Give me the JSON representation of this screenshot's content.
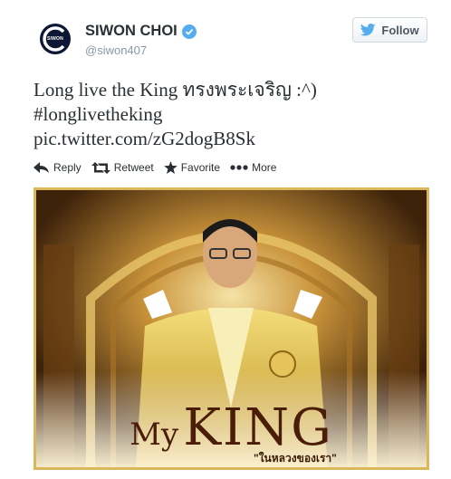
{
  "user": {
    "display_name": "SIWON CHOI",
    "handle": "@siwon407",
    "avatar_text": "SIWON",
    "verified": true
  },
  "follow_button": {
    "label": "Follow"
  },
  "tweet": {
    "lines": [
      "Long live the King ทรงพระเจริญ :^)",
      "#longlivetheking",
      "pic.twitter.com/zG2dogB8Sk"
    ]
  },
  "actions": {
    "reply": "Reply",
    "retweet": "Retweet",
    "favorite": "Favorite",
    "more": "More"
  },
  "photo": {
    "caption_my": "My",
    "caption_king": "KING",
    "caption_sub": "\"ในหลวงของเรา\""
  },
  "colors": {
    "verified": "#55acee",
    "twitter_blue": "#55acee",
    "text": "#292f33",
    "muted": "#8899a6"
  }
}
